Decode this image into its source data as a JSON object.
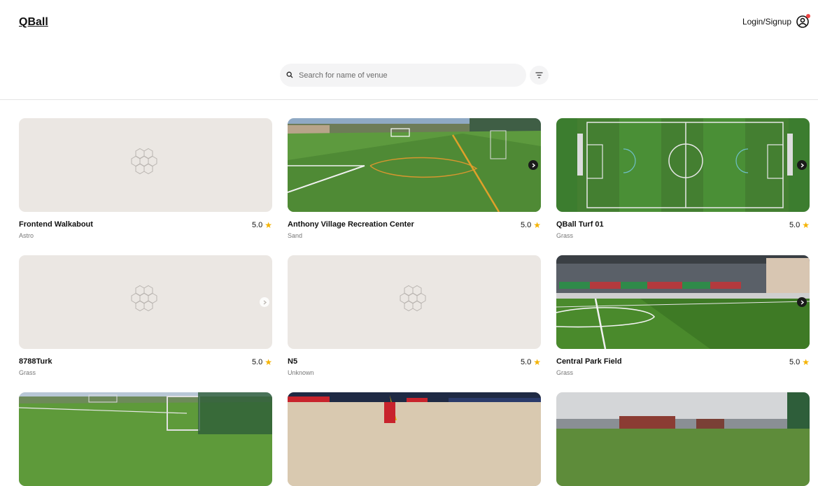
{
  "header": {
    "logo": "QBall",
    "login_label": "Login/Signup"
  },
  "search": {
    "placeholder": "Search for name of venue"
  },
  "venues": [
    {
      "name": "Frontend Walkabout",
      "type": "Astro",
      "rating": "5.0",
      "image": "placeholder"
    },
    {
      "name": "Anthony Village Recreation Center",
      "type": "Sand",
      "rating": "5.0",
      "image": "turf-field-photo"
    },
    {
      "name": "QBall Turf 01",
      "type": "Grass",
      "rating": "5.0",
      "image": "aerial-pitch-photo"
    },
    {
      "name": "8788Turk",
      "type": "Grass",
      "rating": "5.0",
      "image": "placeholder"
    },
    {
      "name": "N5",
      "type": "Unknown",
      "rating": "5.0",
      "image": "placeholder"
    },
    {
      "name": "Central Park Field",
      "type": "Grass",
      "rating": "5.0",
      "image": "stadium-stands-photo"
    },
    {
      "name": "",
      "type": "",
      "rating": "",
      "image": "training-pitch-photo"
    },
    {
      "name": "",
      "type": "",
      "rating": "",
      "image": "sand-stadium-photo"
    },
    {
      "name": "",
      "type": "",
      "rating": "",
      "image": "urban-pitch-photo"
    }
  ],
  "colors": {
    "placeholder_bg": "#ebe7e3",
    "star": "#f5b301",
    "notification_dot": "#ef4444"
  },
  "icons": [
    "search-icon",
    "filter-icon",
    "user-icon",
    "chevron-right-icon",
    "star-icon",
    "hexagon-placeholder-icon"
  ]
}
